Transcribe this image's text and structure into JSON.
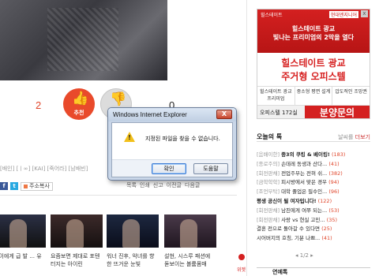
{
  "article": {
    "up_count": "2",
    "up_label": "추천",
    "down_count": "0",
    "tags": "[배인] [ㅣ∞] [KAI] [죽어라] [남배빈]",
    "share_label": "주소복사",
    "tools": [
      "목록",
      "인쇄",
      "신고",
      "이전글",
      "다음글"
    ]
  },
  "related": [
    {
      "caption": "은이에게 급 발 ... 유"
    },
    {
      "caption": "요즘보면 제대로 포텐 터지는 아이린"
    },
    {
      "caption": "워너 진후, 악녀를 향한 뜨거운 눈빛"
    },
    {
      "caption": "설현, 시스루 패션에 돋보이는 볼륨몸매"
    }
  ],
  "ad": {
    "brand_left": "힐스테이트",
    "brand_right": "현대엔지니어",
    "line1": "힐스테이트 광교",
    "line2": "빛나는 프리미엄의 2막을 열다",
    "main1": "힐스테이트 광교",
    "main2": "주거형 오피스텔",
    "cells": [
      "힐스테이트 광교 프리미엄",
      "중소형 평면 설계",
      "압도적인 조망권"
    ],
    "size": "오피스텔 172실",
    "phone": "분양문의 1670-1221"
  },
  "today": {
    "title": "오늘의 톡",
    "more_prefix": "날씨를",
    "more": "더보기",
    "items": [
      {
        "cat": "[음배이한]",
        "text": "중3의 쿠킹 & 베이킹!",
        "count": "(183)",
        "bold": true
      },
      {
        "cat": "[종로주의]",
        "text": "손데레 동생과 산다...",
        "count": "(41)",
        "bold": false
      },
      {
        "cat": "[회전판채]",
        "text": "전업주부는 전혀 쉬...",
        "count": "(382)",
        "bold": false
      },
      {
        "cat": "[금학학학]",
        "text": "피시방에서 맞은 경우",
        "count": "(94)",
        "bold": false
      },
      {
        "cat": "[조언부탁]",
        "text": "대학 졸업은 필수인...",
        "count": "(96)",
        "bold": false
      },
      {
        "cat": "",
        "text": "평생 공신이 될 여자입니다!",
        "count": "(122)",
        "bold": true
      },
      {
        "cat": "[회전판채]",
        "text": "남친에게 여쭈 되는...",
        "count": "(53)",
        "bold": false
      },
      {
        "cat": "[회전판채]",
        "text": "사랑 vs 현실 고민...",
        "count": "(35)",
        "bold": false
      },
      {
        "cat": "",
        "text": "결혼 전으로 돌아갈 수 있다면",
        "count": "(25)",
        "bold": false
      },
      {
        "cat": "",
        "text": "시어버지의 호칭, 기분 나쁘...",
        "count": "(41)",
        "bold": false
      }
    ],
    "pager": "1/2"
  },
  "bottom_bar": "연예톡",
  "side_label": "위젯",
  "dialog": {
    "title": "Windows Internet Explorer",
    "close": "X",
    "message": "지정된 파일을 찾을 수 없습니다.",
    "ok": "확인",
    "help": "도움말",
    "icon": "warning-icon"
  }
}
